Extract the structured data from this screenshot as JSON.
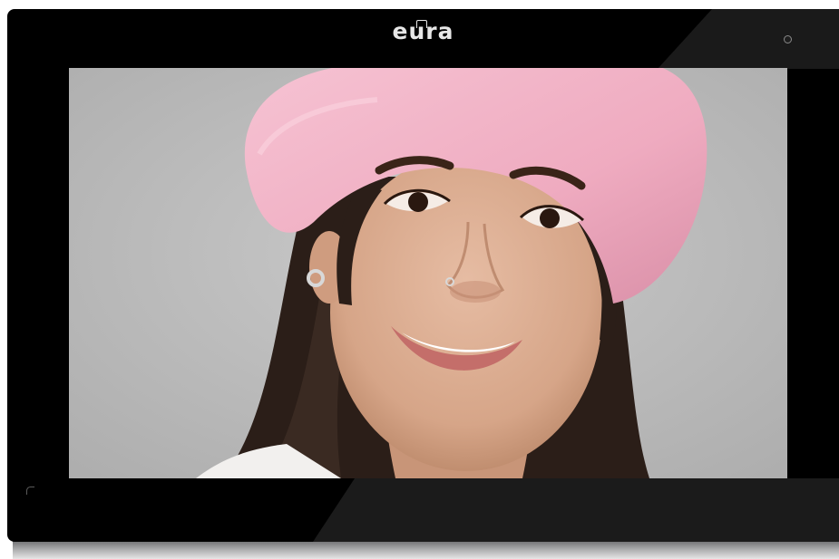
{
  "brand": {
    "logo_text": "eura"
  },
  "screen": {
    "content": "portrait-photo"
  },
  "colors": {
    "bezel": "#000000",
    "screen_background": "#bcbcbc",
    "hat": "#f2b3c8",
    "hair": "#2e201a",
    "skin": "#dcae92",
    "logo": "#e7e7e7"
  }
}
